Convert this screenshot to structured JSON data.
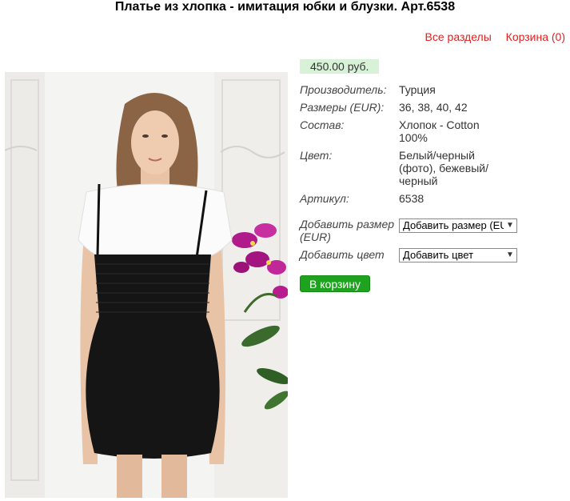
{
  "page": {
    "title": "Платье из хлопка - имитация юбки и блузки. Арт.6538"
  },
  "nav": {
    "all_sections": "Все разделы",
    "cart": "Корзина (0)"
  },
  "product": {
    "price": "450.00 руб.",
    "properties": [
      {
        "label": "Производитель:",
        "value": "Турция"
      },
      {
        "label": "Размеры (EUR):",
        "value": "36, 38, 40, 42"
      },
      {
        "label": "Состав:",
        "value": "Хлопок - Cotton 100%"
      },
      {
        "label": "Цвет:",
        "value": "Белый/черный (фото), бежевый/черный"
      },
      {
        "label": "Артикул:",
        "value": "6538"
      }
    ],
    "size_select": {
      "label": "Добавить размер (EUR)",
      "selected": "Добавить размер (EUR)"
    },
    "color_select": {
      "label": "Добавить цвет",
      "selected": "Добавить цвет"
    },
    "add_to_cart": "В корзину"
  },
  "colors": {
    "link": "#e02020",
    "price_bg": "#d8f2d8",
    "button": "#1ea31e"
  }
}
